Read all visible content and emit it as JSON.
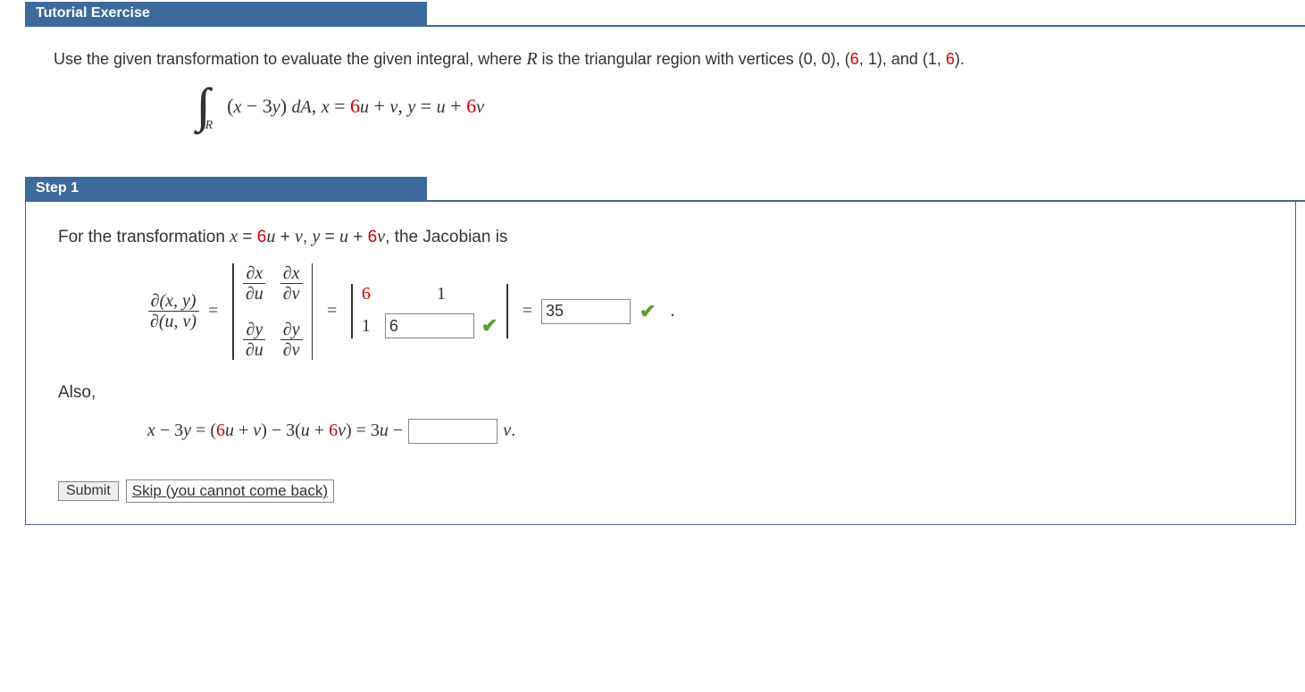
{
  "tutorial": {
    "header": "Tutorial Exercise",
    "prompt_pre": "Use the given transformation to evaluate the given integral, where ",
    "prompt_R": "R",
    "prompt_mid": " is the triangular region with vertices (0, 0), (",
    "v1b": "6",
    "prompt_c1": ", 1), and (1, ",
    "v2b": "6",
    "prompt_end": ").",
    "integrand_pre": "(",
    "integrand_x": "x",
    "integrand_m": " − 3",
    "integrand_y": "y",
    "integrand_post": ") ",
    "dA": "dA",
    "comma": ", ",
    "xeq_x": "x",
    "xeq_eq": " = ",
    "xeq_6": "6",
    "xeq_u": "u",
    "xeq_plus": " + ",
    "xeq_v": "v",
    "yeq_y": "y",
    "yeq_eq": " = ",
    "yeq_u": "u",
    "yeq_plus": " + ",
    "yeq_6": "6",
    "yeq_v": "v"
  },
  "step1": {
    "header": "Step 1",
    "intro_pre": "For the transformation  ",
    "intro_post": "  the Jacobian is",
    "jac_num": "∂(x, y)",
    "jac_den": "∂(u, v)",
    "eq": "=",
    "dxdu_n": "∂x",
    "dxdu_d": "∂u",
    "dxdv_n": "∂x",
    "dxdv_d": "∂v",
    "dydu_n": "∂y",
    "dydu_d": "∂u",
    "dydv_n": "∂y",
    "dydv_d": "∂v",
    "m11": "6",
    "m12": "1",
    "m21": "1",
    "ans_m22": "6",
    "ans_det": "35",
    "period": ".",
    "also": "Also,",
    "line2_a": "x",
    "line2_b": " − 3",
    "line2_c": "y",
    "line2_d": " = (",
    "line2_e": "6",
    "line2_f": "u",
    "line2_g": " + ",
    "line2_h": "v",
    "line2_i": ") − 3(",
    "line2_j": "u",
    "line2_k": " + ",
    "line2_l": "6",
    "line2_m": "v",
    "line2_n": ") = 3",
    "line2_o": "u",
    "line2_p": " − ",
    "line2_q": "v",
    "line2_r": ".",
    "ans_coef": "",
    "submit": "Submit",
    "skip": "Skip (you cannot come back)"
  }
}
